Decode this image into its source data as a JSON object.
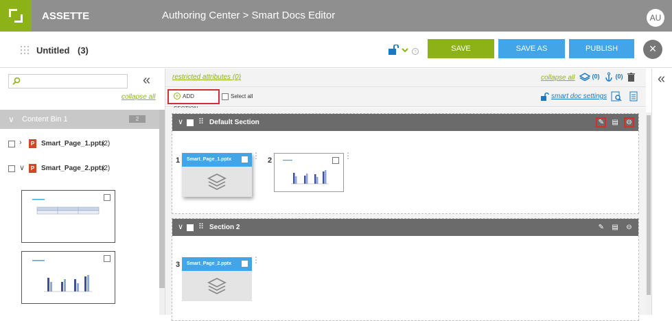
{
  "app": {
    "brand": "ASSETTE",
    "breadcrumb": "Authoring Center > Smart Docs Editor",
    "avatar": "AU"
  },
  "document": {
    "title": "Untitled",
    "count": "(3)"
  },
  "toolbar": {
    "save": "SAVE",
    "save_as": "SAVE AS",
    "publish": "PUBLISH",
    "close": "×"
  },
  "left_panel": {
    "search_placeholder": "",
    "collapse_all": "collapse all",
    "bin": {
      "title": "Content Bin 1",
      "count": "2"
    },
    "files": [
      {
        "name": "Smart_Page_1.pptx",
        "count": "(2)",
        "expanded": false
      },
      {
        "name": "Smart_Page_2.pptx",
        "count": "(2)",
        "expanded": true
      }
    ]
  },
  "editor": {
    "restricted": "restricted attributes (0)",
    "collapse_all": "collapse all",
    "layers_count": "(0)",
    "anchor_count": "(0)",
    "add_section": "ADD SECTION",
    "select_all": "Select all",
    "smart_doc_settings": "smart doc settings",
    "sections": [
      {
        "name": "Default Section",
        "cards": [
          {
            "num": "1",
            "title": "Smart_Page_1.pptx"
          },
          {
            "num": "2",
            "title": ""
          }
        ]
      },
      {
        "name": "Section 2",
        "cards": [
          {
            "num": "3",
            "title": "Smart_Page_2.pptx"
          }
        ]
      }
    ]
  },
  "colors": {
    "accent_green": "#8cb217",
    "accent_blue": "#42a5e8",
    "header_gray": "#8f8f8f",
    "highlight_red": "#d32f2f"
  }
}
